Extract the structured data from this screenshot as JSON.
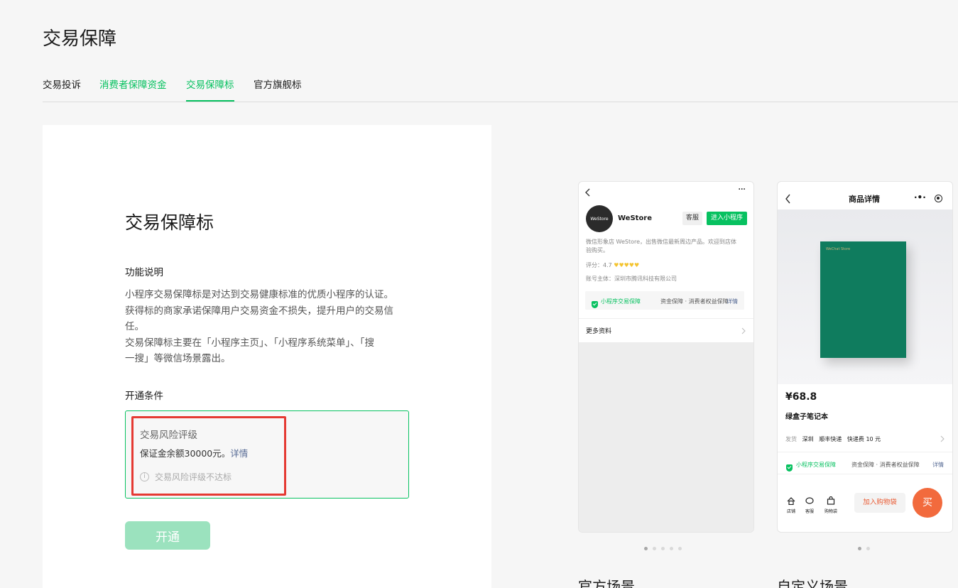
{
  "page": {
    "title": "交易保障"
  },
  "tabs": [
    {
      "label": "交易投诉"
    },
    {
      "label": "消费者保障资金"
    },
    {
      "label": "交易保障标"
    },
    {
      "label": "官方旗舰标"
    }
  ],
  "card": {
    "title": "交易保障标",
    "feature_title": "功能说明",
    "desc_lines": [
      "小程序交易保障标是对达到交易健康标准的优质小程序的认证。",
      "获得标的商家承诺保障用户交易资金不损失，提升用户的交易信",
      "任。",
      "交易保障标主要在「小程序主页」、「小程序系统菜单」、「搜",
      "一搜」等微信场景露出。"
    ],
    "cond_title": "开通条件",
    "condition": {
      "name": "交易风险评级",
      "deposit_text": "保证金余额30000元。",
      "detail_link": "详情",
      "tip": "交易风险评级不达标"
    },
    "open_button": "开通"
  },
  "phone1": {
    "logo_text": "WeStore",
    "name": "WeStore",
    "service_btn": "客服",
    "enter_btn": "进入小程序",
    "desc": [
      "微信形象店 WeStore，出售微信最新周边产品。欢迎到店体",
      "验购买。"
    ],
    "rating_label": "评分：4.7",
    "owner": "账号主体：深圳市腾讯科技有限公司",
    "badge": "小程序交易保障",
    "badge_desc": "资金保障 · 消费者权益保障",
    "badge_link": "详情",
    "more": "更多资料"
  },
  "phone2": {
    "header": "商品详情",
    "book_text": "WeChat Store",
    "price": "¥68.8",
    "product": "绿盒子笔记本",
    "ship_label": "发货",
    "ship_city": "深圳",
    "ship_method": "顺丰快递",
    "ship_fee": "快递费 10 元",
    "badge": "小程序交易保障",
    "badge_desc": "资金保障 · 消费者权益保障",
    "badge_link": "详情",
    "nav": [
      "店铺",
      "客服",
      "购物袋"
    ],
    "cart_btn": "加入购物袋",
    "buy_btn": "买"
  },
  "scenes": {
    "official": "官方场景",
    "custom": "自定义场景"
  },
  "colors": {
    "accent": "#07c160",
    "highlight": "#e53a33",
    "link": "#576b95"
  }
}
